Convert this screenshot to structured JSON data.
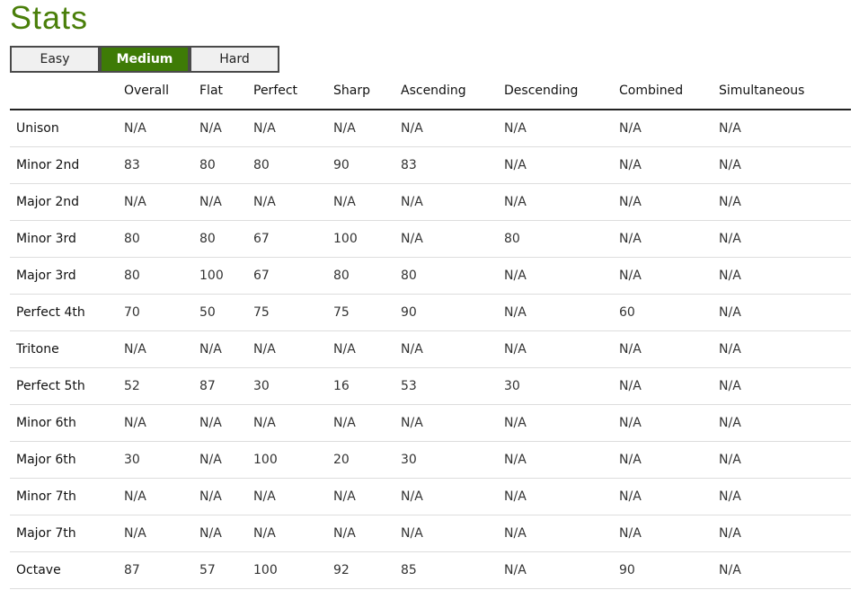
{
  "page": {
    "title": "Stats"
  },
  "colors": {
    "title": "#4a7f0a",
    "active_tab": "#3e7b06"
  },
  "difficulty_tabs": [
    {
      "label": "Easy",
      "active": false
    },
    {
      "label": "Medium",
      "active": true
    },
    {
      "label": "Hard",
      "active": false
    }
  ],
  "table": {
    "headers": [
      "",
      "Overall",
      "Flat",
      "Perfect",
      "Sharp",
      "Ascending",
      "Descending",
      "Combined",
      "Simultaneous"
    ],
    "rows": [
      [
        "Unison",
        "N/A",
        "N/A",
        "N/A",
        "N/A",
        "N/A",
        "N/A",
        "N/A",
        "N/A"
      ],
      [
        "Minor 2nd",
        "83",
        "80",
        "80",
        "90",
        "83",
        "N/A",
        "N/A",
        "N/A"
      ],
      [
        "Major 2nd",
        "N/A",
        "N/A",
        "N/A",
        "N/A",
        "N/A",
        "N/A",
        "N/A",
        "N/A"
      ],
      [
        "Minor 3rd",
        "80",
        "80",
        "67",
        "100",
        "N/A",
        "80",
        "N/A",
        "N/A"
      ],
      [
        "Major 3rd",
        "80",
        "100",
        "67",
        "80",
        "80",
        "N/A",
        "N/A",
        "N/A"
      ],
      [
        "Perfect 4th",
        "70",
        "50",
        "75",
        "75",
        "90",
        "N/A",
        "60",
        "N/A"
      ],
      [
        "Tritone",
        "N/A",
        "N/A",
        "N/A",
        "N/A",
        "N/A",
        "N/A",
        "N/A",
        "N/A"
      ],
      [
        "Perfect 5th",
        "52",
        "87",
        "30",
        "16",
        "53",
        "30",
        "N/A",
        "N/A"
      ],
      [
        "Minor 6th",
        "N/A",
        "N/A",
        "N/A",
        "N/A",
        "N/A",
        "N/A",
        "N/A",
        "N/A"
      ],
      [
        "Major 6th",
        "30",
        "N/A",
        "100",
        "20",
        "30",
        "N/A",
        "N/A",
        "N/A"
      ],
      [
        "Minor 7th",
        "N/A",
        "N/A",
        "N/A",
        "N/A",
        "N/A",
        "N/A",
        "N/A",
        "N/A"
      ],
      [
        "Major 7th",
        "N/A",
        "N/A",
        "N/A",
        "N/A",
        "N/A",
        "N/A",
        "N/A",
        "N/A"
      ],
      [
        "Octave",
        "87",
        "57",
        "100",
        "92",
        "85",
        "N/A",
        "90",
        "N/A"
      ]
    ]
  }
}
